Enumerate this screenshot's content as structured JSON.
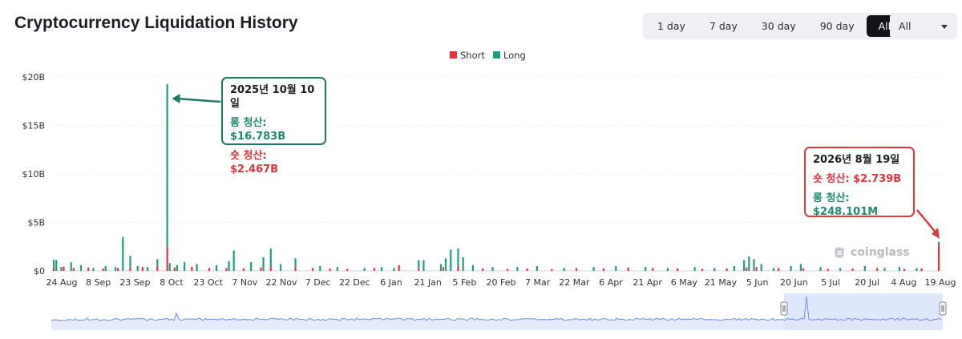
{
  "page": {
    "title": "Cryptocurrency Liquidation History",
    "range_buttons": [
      "1 day",
      "7 day",
      "30 day",
      "90 day",
      "All"
    ],
    "active_range": "All",
    "asset_select": "All",
    "watermark": "coinglass"
  },
  "colors": {
    "short": "#e8323c",
    "long": "#1f9e7f",
    "grid": "#e9ecef",
    "navigator_line": "#6f8ee8",
    "navigator_fill": "#dfe6fa",
    "navigator_selection": "#dbe4fb"
  },
  "annotations": [
    {
      "date": "2025년 10월 10일",
      "line1": "롱 청산: $16.783B",
      "line2": "숏 청산: $2.467B"
    },
    {
      "date": "2026년 8월 19일",
      "line1": "숏 청산: $2.739B",
      "line2": "롱 청산: $248.101M"
    }
  ],
  "chart_data": {
    "type": "bar",
    "stacked": true,
    "title": "",
    "xlabel": "",
    "ylabel": "",
    "ylim": [
      0,
      20000000000
    ],
    "yticks": [
      "$0",
      "$5B",
      "$10B",
      "$15B",
      "$20B"
    ],
    "ytick_values": [
      0,
      5000000000,
      10000000000,
      15000000000,
      20000000000
    ],
    "grid": true,
    "legend": {
      "position": "top-center",
      "entries": [
        "Short",
        "Long"
      ]
    },
    "x_range": [
      "2025-08-24",
      "2026-08-19"
    ],
    "xticks": [
      "24 Aug",
      "8 Sep",
      "23 Sep",
      "8 Oct",
      "23 Oct",
      "7 Nov",
      "22 Nov",
      "7 Dec",
      "22 Dec",
      "6 Jan",
      "21 Jan",
      "5 Feb",
      "20 Feb",
      "7 Mar",
      "22 Mar",
      "6 Apr",
      "21 Apr",
      "6 May",
      "21 May",
      "5 Jun",
      "20 Jun",
      "5 Jul",
      "20 Jul",
      "4 Aug",
      "19 Aug"
    ],
    "series": [
      {
        "name": "Short",
        "color": "#e8323c",
        "points": [
          [
            "2025-08-25",
            0.35
          ],
          [
            "2025-08-29",
            0.45
          ],
          [
            "2025-09-02",
            0.3
          ],
          [
            "2025-09-08",
            0.35
          ],
          [
            "2025-09-14",
            0.25
          ],
          [
            "2025-09-20",
            0.3
          ],
          [
            "2025-09-25",
            0.35
          ],
          [
            "2025-09-30",
            0.4
          ],
          [
            "2025-10-06",
            0.5
          ],
          [
            "2025-10-10",
            2.467
          ],
          [
            "2025-10-13",
            0.35
          ],
          [
            "2025-10-20",
            0.4
          ],
          [
            "2025-10-27",
            0.3
          ],
          [
            "2025-11-03",
            0.3
          ],
          [
            "2025-11-10",
            0.25
          ],
          [
            "2025-11-17",
            0.35
          ],
          [
            "2025-11-21",
            0.4
          ],
          [
            "2025-12-01",
            0.4
          ],
          [
            "2025-12-08",
            0.3
          ],
          [
            "2025-12-15",
            0.25
          ],
          [
            "2025-12-22",
            0.2
          ],
          [
            "2026-01-02",
            0.3
          ],
          [
            "2026-01-12",
            0.6
          ],
          [
            "2026-01-20",
            0.3
          ],
          [
            "2026-01-30",
            0.4
          ],
          [
            "2026-02-05",
            0.5
          ],
          [
            "2026-02-15",
            0.25
          ],
          [
            "2026-02-25",
            0.2
          ],
          [
            "2026-03-05",
            0.25
          ],
          [
            "2026-03-15",
            0.2
          ],
          [
            "2026-03-25",
            0.3
          ],
          [
            "2026-04-05",
            0.25
          ],
          [
            "2026-04-15",
            0.35
          ],
          [
            "2026-04-25",
            0.3
          ],
          [
            "2026-05-05",
            0.25
          ],
          [
            "2026-05-15",
            0.2
          ],
          [
            "2026-05-25",
            0.25
          ],
          [
            "2026-06-02",
            0.35
          ],
          [
            "2026-06-06",
            0.4
          ],
          [
            "2026-06-15",
            0.3
          ],
          [
            "2026-06-25",
            0.25
          ],
          [
            "2026-07-05",
            0.2
          ],
          [
            "2026-07-15",
            0.25
          ],
          [
            "2026-07-25",
            0.3
          ],
          [
            "2026-08-05",
            0.2
          ],
          [
            "2026-08-12",
            0.25
          ],
          [
            "2026-08-19",
            2.739
          ]
        ]
      },
      {
        "name": "Long",
        "color": "#1f9e7f",
        "points": [
          [
            "2025-08-25",
            0.8
          ],
          [
            "2025-08-26",
            1.1
          ],
          [
            "2025-08-28",
            0.4
          ],
          [
            "2025-09-01",
            0.9
          ],
          [
            "2025-09-05",
            0.6
          ],
          [
            "2025-09-10",
            0.3
          ],
          [
            "2025-09-15",
            0.5
          ],
          [
            "2025-09-19",
            0.4
          ],
          [
            "2025-09-22",
            3.5
          ],
          [
            "2025-09-25",
            1.2
          ],
          [
            "2025-09-28",
            0.5
          ],
          [
            "2025-10-02",
            0.4
          ],
          [
            "2025-10-06",
            0.7
          ],
          [
            "2025-10-10",
            16.783
          ],
          [
            "2025-10-11",
            0.8
          ],
          [
            "2025-10-14",
            0.6
          ],
          [
            "2025-10-17",
            0.9
          ],
          [
            "2025-10-22",
            0.7
          ],
          [
            "2025-10-30",
            0.6
          ],
          [
            "2025-11-04",
            1.0
          ],
          [
            "2025-11-06",
            2.1
          ],
          [
            "2025-11-13",
            0.9
          ],
          [
            "2025-11-18",
            1.4
          ],
          [
            "2025-11-21",
            1.9
          ],
          [
            "2025-11-25",
            0.7
          ],
          [
            "2025-12-01",
            0.9
          ],
          [
            "2025-12-11",
            0.5
          ],
          [
            "2025-12-18",
            0.4
          ],
          [
            "2025-12-29",
            0.3
          ],
          [
            "2026-01-05",
            0.4
          ],
          [
            "2026-01-10",
            0.3
          ],
          [
            "2026-01-20",
            0.8
          ],
          [
            "2026-01-22",
            1.1
          ],
          [
            "2026-01-29",
            0.7
          ],
          [
            "2026-01-31",
            1.3
          ],
          [
            "2026-02-02",
            2.2
          ],
          [
            "2026-02-05",
            1.8
          ],
          [
            "2026-02-07",
            1.4
          ],
          [
            "2026-02-11",
            0.6
          ],
          [
            "2026-02-19",
            0.4
          ],
          [
            "2026-03-01",
            0.4
          ],
          [
            "2026-03-09",
            0.5
          ],
          [
            "2026-03-20",
            0.3
          ],
          [
            "2026-04-01",
            0.4
          ],
          [
            "2026-04-10",
            0.5
          ],
          [
            "2026-04-22",
            0.4
          ],
          [
            "2026-05-01",
            0.3
          ],
          [
            "2026-05-12",
            0.4
          ],
          [
            "2026-05-20",
            0.3
          ],
          [
            "2026-05-28",
            0.5
          ],
          [
            "2026-06-01",
            1.1
          ],
          [
            "2026-06-03",
            1.5
          ],
          [
            "2026-06-05",
            1.2
          ],
          [
            "2026-06-08",
            0.7
          ],
          [
            "2026-06-13",
            0.3
          ],
          [
            "2026-06-20",
            0.5
          ],
          [
            "2026-06-24",
            0.7
          ],
          [
            "2026-07-02",
            0.4
          ],
          [
            "2026-07-10",
            0.3
          ],
          [
            "2026-07-20",
            0.5
          ],
          [
            "2026-07-28",
            0.3
          ],
          [
            "2026-08-03",
            0.4
          ],
          [
            "2026-08-10",
            0.3
          ],
          [
            "2026-08-19",
            0.248
          ]
        ]
      }
    ]
  }
}
